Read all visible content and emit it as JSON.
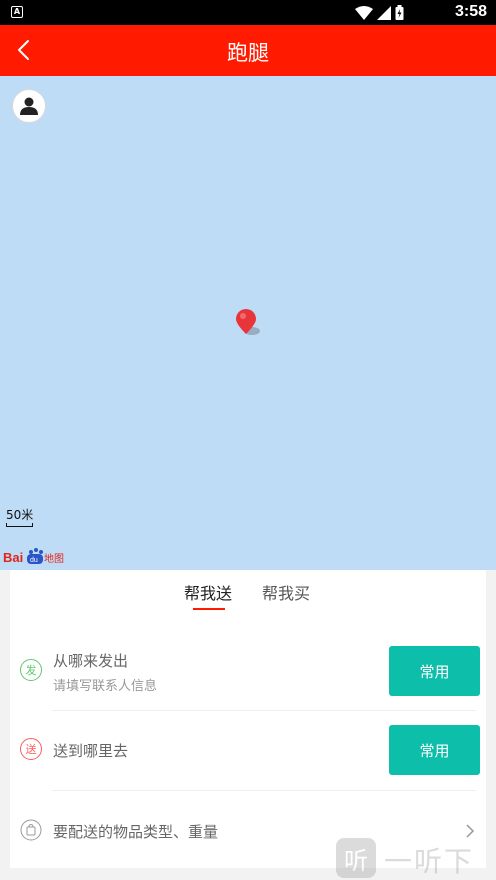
{
  "status_bar": {
    "notification_icon": "A",
    "time": "3:58",
    "icons": [
      "wifi-icon",
      "signal-icon",
      "battery-icon"
    ]
  },
  "header": {
    "title": "跑腿",
    "back_icon": "chevron-left-icon",
    "background_color": "#ff1a00"
  },
  "map": {
    "background_color": "#bfdcf7",
    "scale_label": "50米",
    "logo_text": "Baidu地图"
  },
  "tabs": [
    {
      "label": "帮我送",
      "active": true
    },
    {
      "label": "帮我买",
      "active": false
    }
  ],
  "form": {
    "from": {
      "icon_text": "发",
      "title": "从哪来发出",
      "subtitle": "请填写联系人信息",
      "button_label": "常用"
    },
    "to": {
      "icon_text": "送",
      "title": "送到哪里去",
      "button_label": "常用"
    },
    "item": {
      "title": "要配送的物品类型、重量"
    }
  },
  "watermark": {
    "icon_text": "听",
    "text": "一听下载"
  },
  "colors": {
    "accent": "#ff1a00",
    "button": "#0dbfaa",
    "from_icon": "#5cc86f",
    "to_icon": "#ff5a5a"
  }
}
